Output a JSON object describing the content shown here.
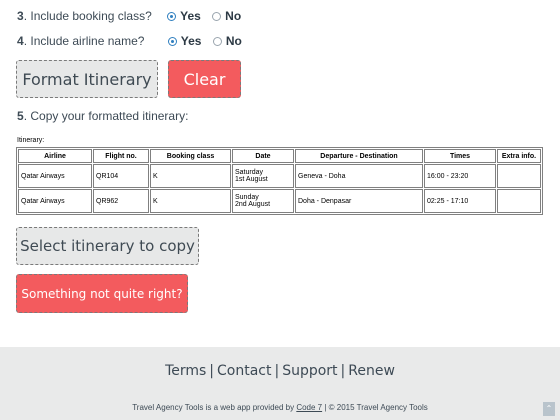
{
  "q3": {
    "num": "3",
    "label": ". Include booking class?",
    "yes": "Yes",
    "no": "No"
  },
  "q4": {
    "num": "4",
    "label": ". Include airline name?",
    "yes": "Yes",
    "no": "No"
  },
  "buttons": {
    "format": "Format Itinerary",
    "clear": "Clear",
    "select": "Select itinerary to copy",
    "report": "Something not quite right?"
  },
  "q5": {
    "num": "5",
    "label": ". Copy your formatted itinerary:"
  },
  "itinerary_label": "Itinerary:",
  "table": {
    "headers": [
      "Airline",
      "Flight no.",
      "Booking class",
      "Date",
      "Departure - Destination",
      "Times",
      "Extra info."
    ],
    "rows": [
      {
        "airline": "Qatar Airways",
        "flight": "QR104",
        "class": "K",
        "date1": "Saturday",
        "date2": "1st August",
        "route": "Geneva - Doha",
        "times": "16:00 - 23:20",
        "extra": ""
      },
      {
        "airline": "Qatar Airways",
        "flight": "QR962",
        "class": "K",
        "date1": "Sunday",
        "date2": "2nd August",
        "route": "Doha - Denpasar",
        "times": "02:25 - 17:10",
        "extra": ""
      }
    ]
  },
  "footer": {
    "links": [
      "Terms",
      "Contact",
      "Support",
      "Renew"
    ],
    "credit_pre": "Travel Agency Tools is a web app provided by ",
    "credit_link": "Code 7",
    "credit_post": " | © 2015 Travel Agency Tools",
    "scroll_glyph": "⌃"
  }
}
